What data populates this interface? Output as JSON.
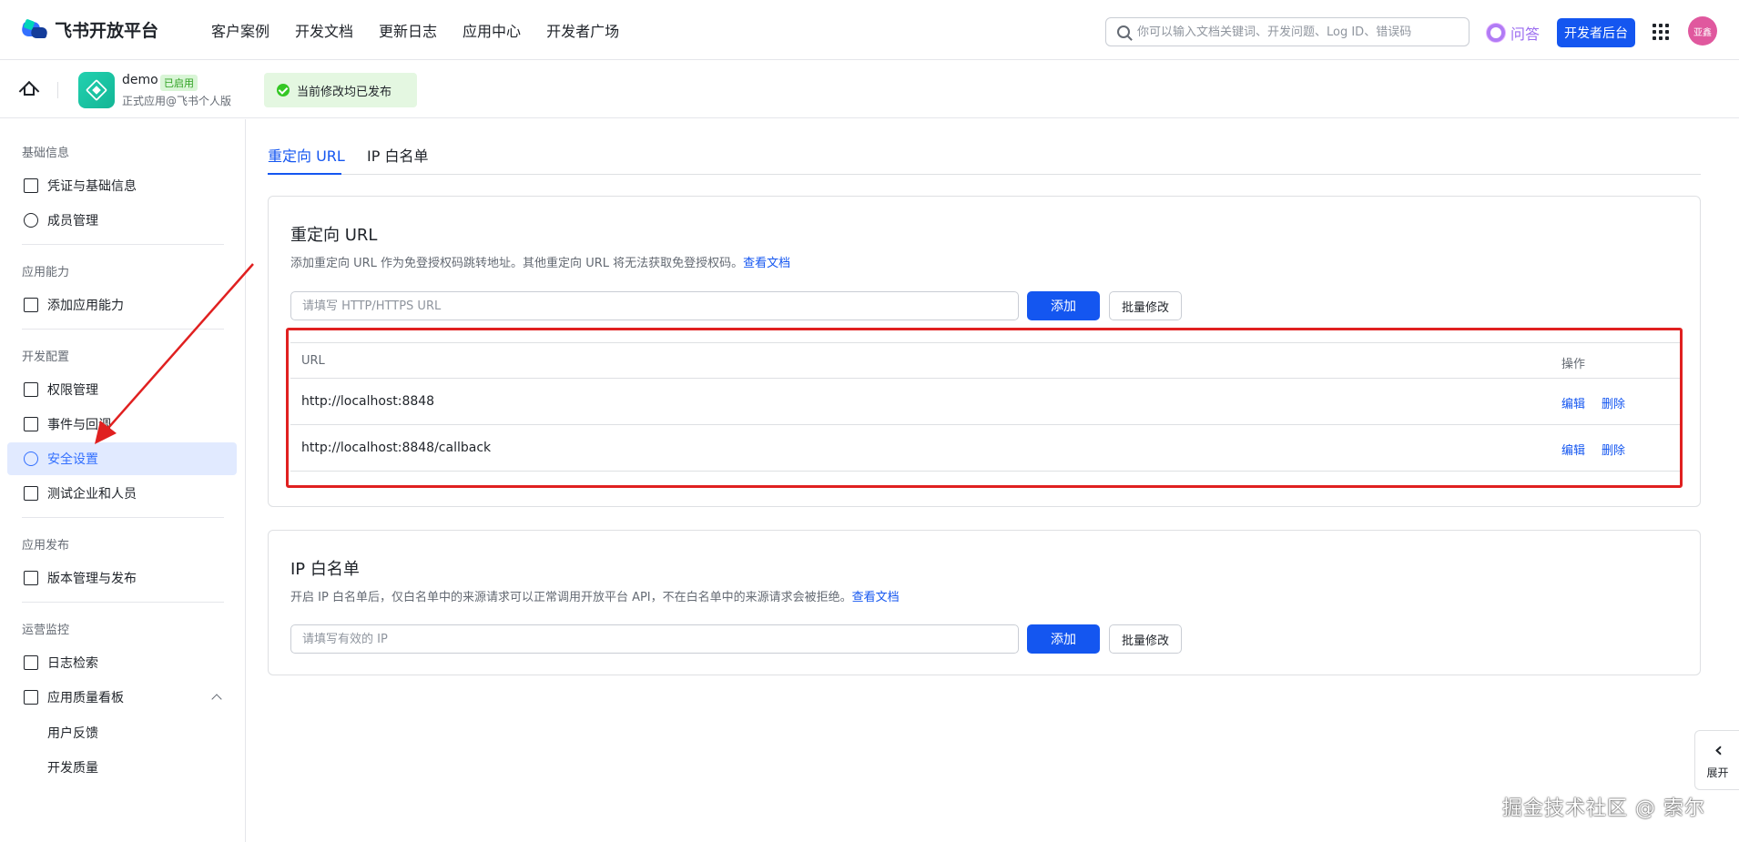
{
  "topnav": {
    "logo_text": "飞书开放平台",
    "menu": [
      "客户案例",
      "开发文档",
      "更新日志",
      "应用中心",
      "开发者广场"
    ],
    "search_placeholder": "你可以输入文档关键词、开发问题、Log ID、错误码",
    "qa_label": "问答",
    "dev_console_label": "开发者后台",
    "avatar_text": "亚鑫"
  },
  "appbar": {
    "app_name": "demo",
    "app_badge": "已启用",
    "app_subtitle": "正式应用@飞书个人版",
    "publish_status": "当前修改均已发布"
  },
  "sidebar": {
    "sections": [
      {
        "title": "基础信息",
        "items": [
          "凭证与基础信息",
          "成员管理"
        ]
      },
      {
        "title": "应用能力",
        "items": [
          "添加应用能力"
        ]
      },
      {
        "title": "开发配置",
        "items": [
          "权限管理",
          "事件与回调",
          "安全设置",
          "测试企业和人员"
        ]
      },
      {
        "title": "应用发布",
        "items": [
          "版本管理与发布"
        ]
      },
      {
        "title": "运营监控",
        "items": [
          "日志检索",
          "应用质量看板"
        ]
      }
    ],
    "sub_items": [
      "用户反馈",
      "开发质量"
    ],
    "active_item": "安全设置"
  },
  "tabs": [
    "重定向 URL",
    "IP 白名单"
  ],
  "redirect_card": {
    "title": "重定向 URL",
    "desc": "添加重定向 URL 作为免登授权码跳转地址。其他重定向 URL 将无法获取免登授权码。",
    "doc_link": "查看文档",
    "input_placeholder": "请填写 HTTP/HTTPS URL",
    "add_label": "添加",
    "batch_label": "批量修改",
    "table": {
      "headers": [
        "URL",
        "操作"
      ],
      "rows": [
        {
          "url": "http://localhost:8848",
          "edit": "编辑",
          "delete": "删除"
        },
        {
          "url": "http://localhost:8848/callback",
          "edit": "编辑",
          "delete": "删除"
        }
      ]
    }
  },
  "ip_card": {
    "title": "IP 白名单",
    "desc": "开启 IP 白名单后，仅白名单中的来源请求可以正常调用开放平台 API，不在白名单中的来源请求会被拒绝。",
    "doc_link": "查看文档",
    "input_placeholder": "请填写有效的 IP",
    "add_label": "添加",
    "batch_label": "批量修改"
  },
  "expand_label": "展开",
  "watermark": "掘金技术社区 @ 索尔",
  "colors": {
    "primary": "#1456f0",
    "highlight": "#e02020",
    "active_bg": "#e1eaff"
  }
}
